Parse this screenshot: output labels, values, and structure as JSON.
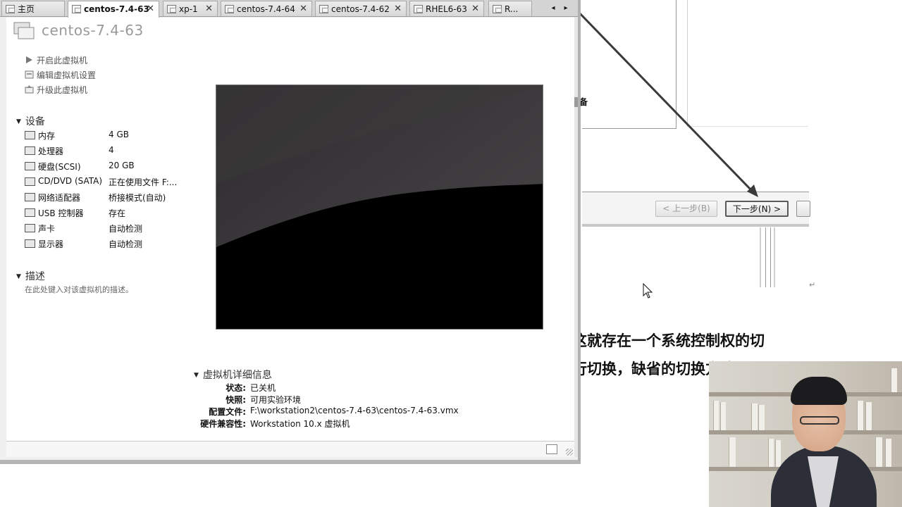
{
  "tabs": [
    {
      "label": "主页",
      "active": false,
      "closable": false
    },
    {
      "label": "centos-7.4-63",
      "active": true,
      "closable": true
    },
    {
      "label": "xp-1",
      "active": false,
      "closable": true
    },
    {
      "label": "centos-7.4-64",
      "active": false,
      "closable": true
    },
    {
      "label": "centos-7.4-62",
      "active": false,
      "closable": true
    },
    {
      "label": "RHEL6-63",
      "active": false,
      "closable": true
    },
    {
      "label": "R...",
      "active": false,
      "closable": false
    }
  ],
  "tab_close_glyph": "✕",
  "vm": {
    "title": "centos-7.4-63",
    "actions": [
      {
        "label": "开启此虚拟机",
        "icon": "play-icon"
      },
      {
        "label": "编辑虚拟机设置",
        "icon": "edit-settings-icon"
      },
      {
        "label": "升级此虚拟机",
        "icon": "upgrade-icon"
      }
    ],
    "devices_heading": "设备",
    "devices": [
      {
        "name": "内存",
        "value": "4 GB",
        "icon": "memory-icon"
      },
      {
        "name": "处理器",
        "value": "4",
        "icon": "processor-icon"
      },
      {
        "name": "硬盘(SCSI)",
        "value": "20 GB",
        "icon": "hard-disk-icon"
      },
      {
        "name": "CD/DVD (SATA)",
        "value": "正在使用文件 F:...",
        "icon": "cd-dvd-icon"
      },
      {
        "name": "网络适配器",
        "value": "桥接模式(自动)",
        "icon": "network-adapter-icon"
      },
      {
        "name": "USB 控制器",
        "value": "存在",
        "icon": "usb-icon"
      },
      {
        "name": "声卡",
        "value": "自动检测",
        "icon": "sound-card-icon"
      },
      {
        "name": "显示器",
        "value": "自动检测",
        "icon": "display-icon"
      }
    ],
    "description_heading": "描述",
    "description_placeholder": "在此处键入对该虚拟机的描述。",
    "details_heading": "虚拟机详细信息",
    "details": [
      {
        "label": "状态:",
        "value": "已关机"
      },
      {
        "label": "快照:",
        "value": "可用实验环境"
      },
      {
        "label": "配置文件:",
        "value": "F:\\workstation2\\centos-7.4-63\\centos-7.4-63.vmx"
      },
      {
        "label": "硬件兼容性:",
        "value": "Workstation 10.x 虚拟机"
      }
    ]
  },
  "wizard": {
    "prev_label": "< 上一步(B)",
    "next_label": "下一步(N) >",
    "partial_label": "备",
    "paragraph_mark": "↵"
  },
  "document": {
    "line1": "这就存在一个系统控制权的切",
    "line2": "行切换，缺省的切换方法是"
  },
  "colors": {
    "preview_bg": "#000000",
    "window_bg": "#f0f0f0",
    "arrow": "#3a3a3a"
  }
}
